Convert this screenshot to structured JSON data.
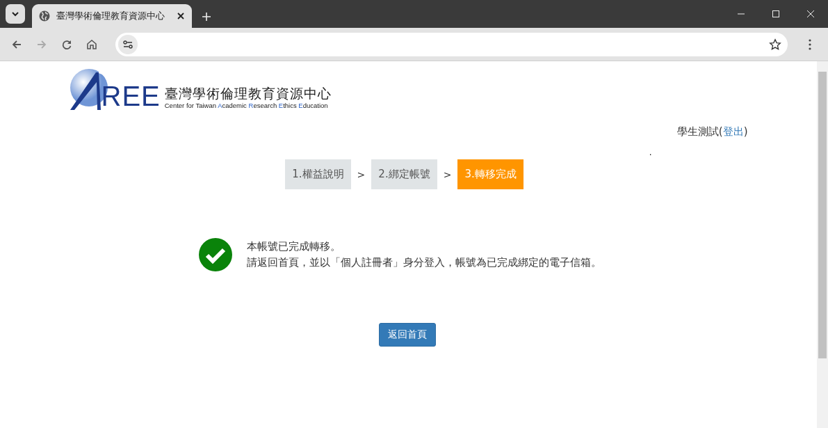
{
  "browser": {
    "tab_title": "臺灣學術倫理教育資源中心"
  },
  "logo": {
    "letters": "REE",
    "title": "臺灣學術倫理教育資源中心",
    "subtitle": [
      {
        "text": "Center for Taiwan ",
        "accent": false
      },
      {
        "text": "A",
        "accent": true
      },
      {
        "text": "cademic ",
        "accent": false
      },
      {
        "text": "R",
        "accent": true
      },
      {
        "text": "esearch ",
        "accent": false
      },
      {
        "text": "E",
        "accent": true
      },
      {
        "text": "thics ",
        "accent": false
      },
      {
        "text": "E",
        "accent": true
      },
      {
        "text": "ducation",
        "accent": false
      }
    ]
  },
  "user": {
    "name": "學生測試",
    "open": "(",
    "logout": "登出",
    "close": ")"
  },
  "stray_mark": ".",
  "steps": [
    {
      "label": "1.權益說明",
      "selected": false
    },
    {
      "label": "2.綁定帳號",
      "selected": false
    },
    {
      "label": "3.轉移完成",
      "selected": true
    }
  ],
  "step_separator": ">",
  "message": {
    "lines": [
      "本帳號已完成轉移。",
      "請返回首頁，並以「個人註冊者」身分登入，帳號為已完成綁定的電子信箱。"
    ]
  },
  "button": "返回首頁"
}
